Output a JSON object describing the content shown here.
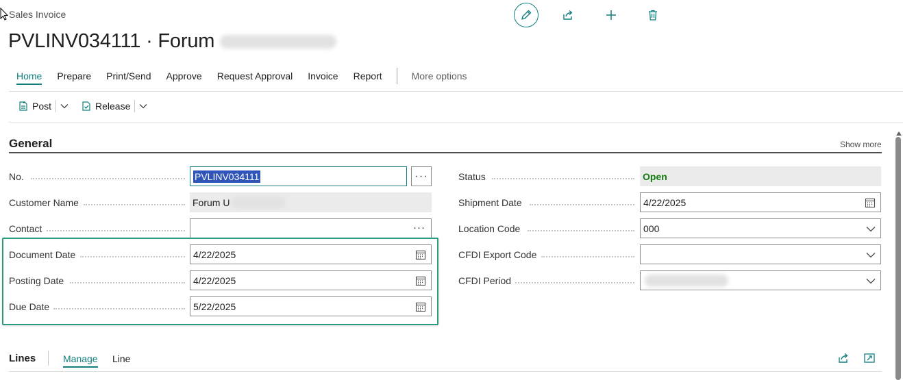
{
  "page": {
    "type_label": "Sales Invoice",
    "title_number": "PVLINV034111",
    "title_separator": "·",
    "title_customer": "Forum",
    "colors": {
      "accent": "#117f7f",
      "highlight_frame": "#2a9d7f",
      "status_open": "#107c10"
    }
  },
  "top_actions": [
    {
      "name": "edit-icon"
    },
    {
      "name": "share-icon"
    },
    {
      "name": "plus-icon"
    },
    {
      "name": "trash-icon"
    }
  ],
  "menu": {
    "items": [
      "Home",
      "Prepare",
      "Print/Send",
      "Approve",
      "Request Approval",
      "Invoice",
      "Report"
    ],
    "active_index": 0,
    "more_options": "More options"
  },
  "actions": {
    "post": "Post",
    "release": "Release"
  },
  "general": {
    "title": "General",
    "show_more": "Show more",
    "left": {
      "no_label": "No.",
      "no_value": "PVLINV034111",
      "customer_name_label": "Customer Name",
      "customer_name_value": "Forum U",
      "contact_label": "Contact",
      "contact_value": "",
      "document_date_label": "Document Date",
      "document_date_value": "4/22/2025",
      "posting_date_label": "Posting Date",
      "posting_date_value": "4/22/2025",
      "due_date_label": "Due Date",
      "due_date_value": "5/22/2025"
    },
    "right": {
      "status_label": "Status",
      "status_value": "Open",
      "shipment_date_label": "Shipment Date",
      "shipment_date_value": "4/22/2025",
      "location_code_label": "Location Code",
      "location_code_value": "000",
      "cfdi_export_code_label": "CFDI Export Code",
      "cfdi_export_code_value": "",
      "cfdi_period_label": "CFDI Period",
      "cfdi_period_value": ""
    }
  },
  "lines": {
    "title": "Lines",
    "manage": "Manage",
    "line": "Line"
  }
}
